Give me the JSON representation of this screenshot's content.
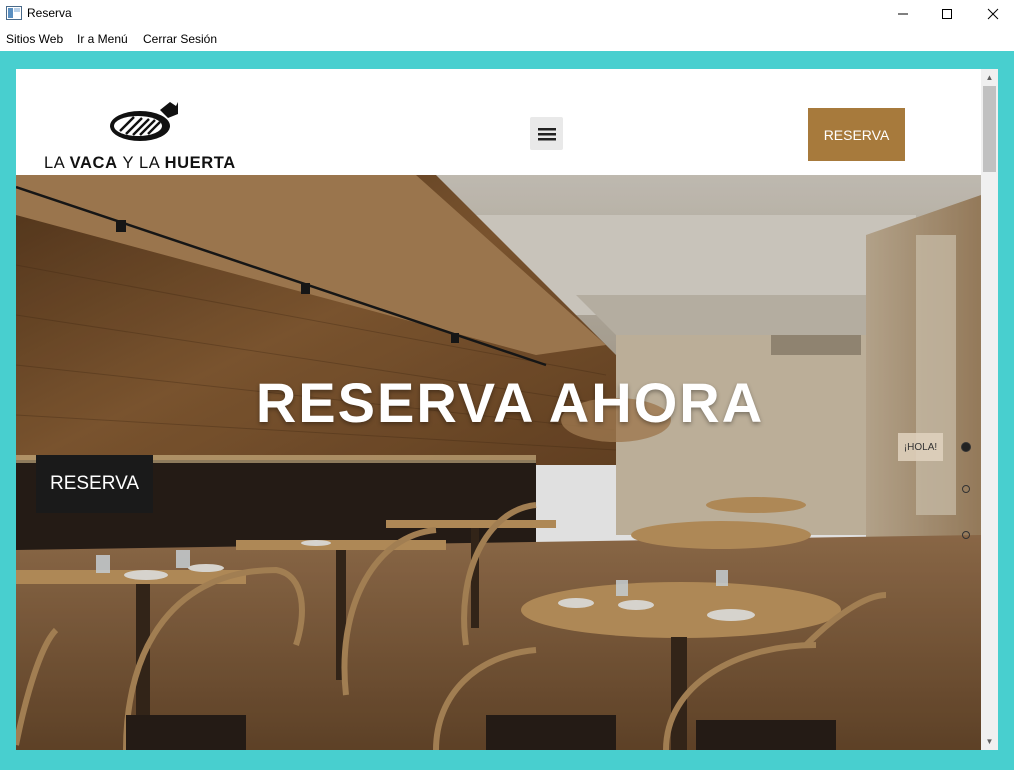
{
  "window": {
    "title": "Reserva",
    "minimize": "─",
    "maximize": "☐",
    "close": "✕"
  },
  "menu": {
    "items": [
      "Sitios Web",
      "Ir a Menú",
      "Cerrar Sesión"
    ]
  },
  "site": {
    "logo": {
      "part1": "LA ",
      "part2": "VACA",
      "part3": " Y LA ",
      "part4": "HUERTA"
    },
    "header_button": "RESERVA"
  },
  "hero": {
    "title": "RESERVA AHORA",
    "button": "RESERVA",
    "side_tab": "¡HOLA!"
  },
  "scrollbar": {
    "up": "▲",
    "down": "▼"
  },
  "colors": {
    "frame": "#48cfcf",
    "accent_button": "#a77a3c",
    "dark_button": "#1a1a1a"
  }
}
